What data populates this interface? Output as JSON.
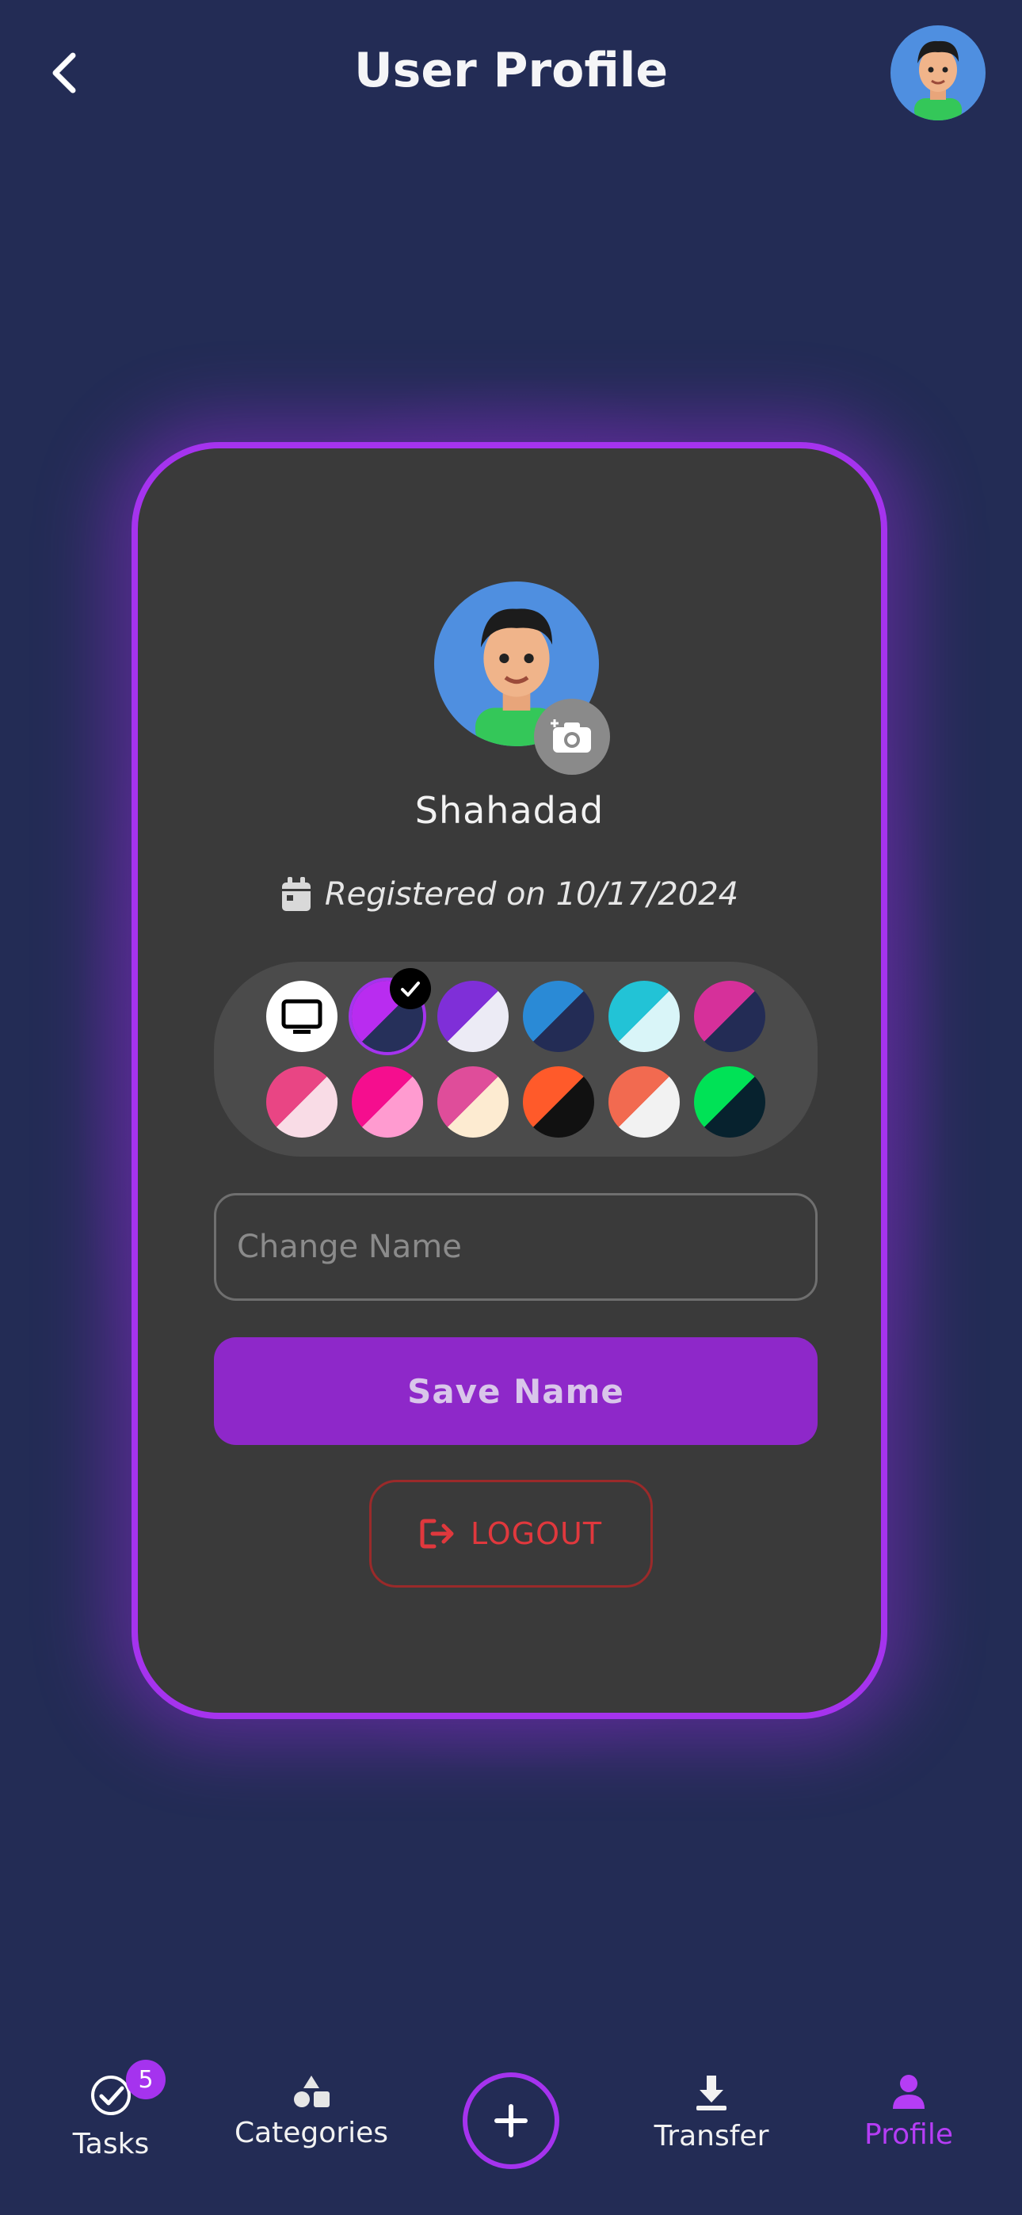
{
  "header": {
    "title": "User Profile",
    "back_icon": "chevron-left-icon",
    "avatar_icon": "user-avatar-icon"
  },
  "profile": {
    "name": "Shahadad",
    "registered_text": "Registered on 10/17/2024",
    "calendar_icon": "calendar-icon",
    "camera_icon": "camera-add-icon"
  },
  "themes": {
    "selected_index": 1,
    "swatches": [
      {
        "name": "system",
        "a": "#ffffff",
        "b": "#ffffff"
      },
      {
        "name": "purple-dark",
        "a": "#b92cf0",
        "b": "#26305a"
      },
      {
        "name": "violet-light",
        "a": "#7f2fd8",
        "b": "#ecebf5"
      },
      {
        "name": "blue-dark",
        "a": "#2a8ad6",
        "b": "#232c55"
      },
      {
        "name": "cyan-light",
        "a": "#22c3d6",
        "b": "#d9f5f8"
      },
      {
        "name": "magenta-dark",
        "a": "#d6309a",
        "b": "#232c55"
      },
      {
        "name": "pink-light",
        "a": "#e94584",
        "b": "#f9dce6"
      },
      {
        "name": "hotpink-light",
        "a": "#f50e8e",
        "b": "#ff9bd0"
      },
      {
        "name": "rose-cream",
        "a": "#df4d9a",
        "b": "#fdebd1"
      },
      {
        "name": "orange-black",
        "a": "#ff5a2a",
        "b": "#111111"
      },
      {
        "name": "coral-white",
        "a": "#f26a50",
        "b": "#f2f2f2"
      },
      {
        "name": "green-navy",
        "a": "#00e256",
        "b": "#07222e"
      }
    ]
  },
  "form": {
    "name_placeholder": "Change Name",
    "name_value": "",
    "save_label": "Save Name",
    "logout_label": "LOGOUT",
    "logout_icon": "logout-icon"
  },
  "nav": {
    "items": [
      {
        "label": "Tasks",
        "icon": "tasks-check-icon",
        "badge": "5"
      },
      {
        "label": "Categories",
        "icon": "categories-shapes-icon"
      },
      {
        "label": "Transfer",
        "icon": "download-icon"
      },
      {
        "label": "Profile",
        "icon": "profile-icon"
      }
    ],
    "add_icon": "plus-icon",
    "active": "Profile"
  },
  "colors": {
    "background": "#232c55",
    "card": "#3a3a3a",
    "accent": "#a533ee",
    "save_button": "#8e28c9",
    "danger": "#e0383d"
  }
}
